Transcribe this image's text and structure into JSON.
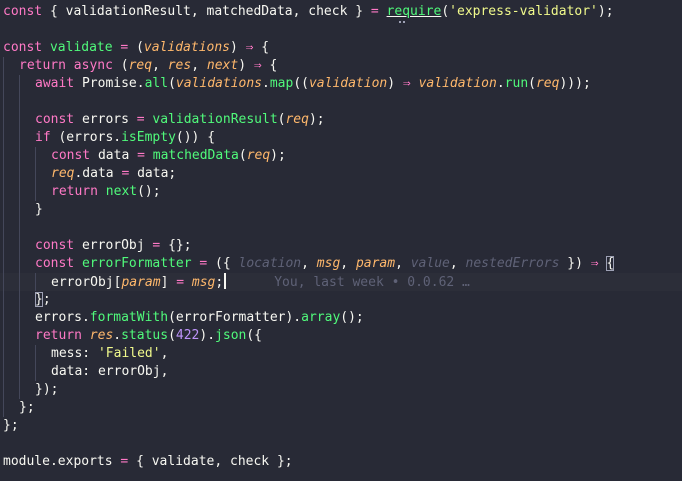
{
  "theme": {
    "background": "#282a36",
    "current_line": "#2c2e39",
    "plain": "#f8f8f2",
    "keyword": "#ff79c6",
    "function": "#50fa7b",
    "param": "#ffb86c",
    "string": "#f1fa8c",
    "number": "#bd93f9",
    "blame": "#5f6277",
    "guide": "#44475a"
  },
  "editor": {
    "current_line": 15,
    "git_blame": "You, last week • 0.0.62 …",
    "lines": [
      {
        "indent": 0,
        "tokens": [
          {
            "t": "const",
            "s": "kw"
          },
          {
            "t": " { ",
            "s": "pl"
          },
          {
            "t": "validationResult",
            "s": "pl"
          },
          {
            "t": ", ",
            "s": "pl"
          },
          {
            "t": "matchedData",
            "s": "pl"
          },
          {
            "t": ", ",
            "s": "pl"
          },
          {
            "t": "check",
            "s": "pl"
          },
          {
            "t": " } ",
            "s": "pl"
          },
          {
            "t": "=",
            "s": "kw"
          },
          {
            "t": " ",
            "s": "pl"
          },
          {
            "t": "require",
            "s": "fn",
            "deco": "ul"
          },
          {
            "t": "(",
            "s": "pl"
          },
          {
            "t": "'express-validator'",
            "s": "str"
          },
          {
            "t": ");",
            "s": "pl"
          }
        ]
      },
      {
        "indent": 0,
        "tokens": []
      },
      {
        "indent": 0,
        "tokens": [
          {
            "t": "const",
            "s": "kw"
          },
          {
            "t": " ",
            "s": "pl"
          },
          {
            "t": "validate",
            "s": "fn"
          },
          {
            "t": " ",
            "s": "pl"
          },
          {
            "t": "=",
            "s": "kw"
          },
          {
            "t": " (",
            "s": "pl"
          },
          {
            "t": "validations",
            "s": "par"
          },
          {
            "t": ") ",
            "s": "pl"
          },
          {
            "t": "⇒",
            "s": "kw"
          },
          {
            "t": " {",
            "s": "pl"
          }
        ]
      },
      {
        "indent": 1,
        "tokens": [
          {
            "t": "return",
            "s": "kw"
          },
          {
            "t": " ",
            "s": "pl"
          },
          {
            "t": "async",
            "s": "kw"
          },
          {
            "t": " (",
            "s": "pl"
          },
          {
            "t": "req",
            "s": "par"
          },
          {
            "t": ", ",
            "s": "pl"
          },
          {
            "t": "res",
            "s": "par"
          },
          {
            "t": ", ",
            "s": "pl"
          },
          {
            "t": "next",
            "s": "par"
          },
          {
            "t": ") ",
            "s": "pl"
          },
          {
            "t": "⇒",
            "s": "kw"
          },
          {
            "t": " {",
            "s": "pl"
          }
        ]
      },
      {
        "indent": 2,
        "tokens": [
          {
            "t": "await",
            "s": "kw"
          },
          {
            "t": " Promise.",
            "s": "pl"
          },
          {
            "t": "all",
            "s": "fn"
          },
          {
            "t": "(",
            "s": "pl"
          },
          {
            "t": "validations",
            "s": "par"
          },
          {
            "t": ".",
            "s": "pl"
          },
          {
            "t": "map",
            "s": "fn"
          },
          {
            "t": "((",
            "s": "pl"
          },
          {
            "t": "validation",
            "s": "par"
          },
          {
            "t": ") ",
            "s": "pl"
          },
          {
            "t": "⇒",
            "s": "kw"
          },
          {
            "t": " ",
            "s": "pl"
          },
          {
            "t": "validation",
            "s": "par"
          },
          {
            "t": ".",
            "s": "pl"
          },
          {
            "t": "run",
            "s": "fn"
          },
          {
            "t": "(",
            "s": "pl"
          },
          {
            "t": "req",
            "s": "par"
          },
          {
            "t": ")));",
            "s": "pl"
          }
        ]
      },
      {
        "indent": 2,
        "tokens": []
      },
      {
        "indent": 2,
        "tokens": [
          {
            "t": "const",
            "s": "kw"
          },
          {
            "t": " errors ",
            "s": "pl"
          },
          {
            "t": "=",
            "s": "kw"
          },
          {
            "t": " ",
            "s": "pl"
          },
          {
            "t": "validationResult",
            "s": "fn"
          },
          {
            "t": "(",
            "s": "pl"
          },
          {
            "t": "req",
            "s": "par"
          },
          {
            "t": ");",
            "s": "pl"
          }
        ]
      },
      {
        "indent": 2,
        "tokens": [
          {
            "t": "if",
            "s": "kw"
          },
          {
            "t": " (errors.",
            "s": "pl"
          },
          {
            "t": "isEmpty",
            "s": "fn"
          },
          {
            "t": "()) {",
            "s": "pl"
          }
        ]
      },
      {
        "indent": 3,
        "tokens": [
          {
            "t": "const",
            "s": "kw"
          },
          {
            "t": " data ",
            "s": "pl"
          },
          {
            "t": "=",
            "s": "kw"
          },
          {
            "t": " ",
            "s": "pl"
          },
          {
            "t": "matchedData",
            "s": "fn"
          },
          {
            "t": "(",
            "s": "pl"
          },
          {
            "t": "req",
            "s": "par"
          },
          {
            "t": ");",
            "s": "pl"
          }
        ]
      },
      {
        "indent": 3,
        "tokens": [
          {
            "t": "req",
            "s": "par"
          },
          {
            "t": ".data ",
            "s": "pl"
          },
          {
            "t": "=",
            "s": "kw"
          },
          {
            "t": " data;",
            "s": "pl"
          }
        ]
      },
      {
        "indent": 3,
        "tokens": [
          {
            "t": "return",
            "s": "kw"
          },
          {
            "t": " ",
            "s": "pl"
          },
          {
            "t": "next",
            "s": "fn"
          },
          {
            "t": "();",
            "s": "pl"
          }
        ]
      },
      {
        "indent": 2,
        "tokens": [
          {
            "t": "}",
            "s": "pl"
          }
        ]
      },
      {
        "indent": 2,
        "tokens": []
      },
      {
        "indent": 2,
        "tokens": [
          {
            "t": "const",
            "s": "kw"
          },
          {
            "t": " errorObj ",
            "s": "pl"
          },
          {
            "t": "=",
            "s": "kw"
          },
          {
            "t": " {};",
            "s": "pl"
          }
        ]
      },
      {
        "indent": 2,
        "tokens": [
          {
            "t": "const",
            "s": "kw"
          },
          {
            "t": " ",
            "s": "pl"
          },
          {
            "t": "errorFormatter",
            "s": "fn"
          },
          {
            "t": " ",
            "s": "pl"
          },
          {
            "t": "=",
            "s": "kw"
          },
          {
            "t": " ({ ",
            "s": "pl"
          },
          {
            "t": "location",
            "s": "cmt"
          },
          {
            "t": ", ",
            "s": "pl"
          },
          {
            "t": "msg",
            "s": "par"
          },
          {
            "t": ", ",
            "s": "pl"
          },
          {
            "t": "param",
            "s": "par"
          },
          {
            "t": ", ",
            "s": "pl"
          },
          {
            "t": "value",
            "s": "cmt"
          },
          {
            "t": ", ",
            "s": "pl"
          },
          {
            "t": "nestedErrors",
            "s": "cmt"
          },
          {
            "t": " }) ",
            "s": "pl"
          },
          {
            "t": "⇒",
            "s": "kw"
          },
          {
            "t": " ",
            "s": "pl"
          },
          {
            "t": "{",
            "s": "pl",
            "deco": "bm"
          }
        ]
      },
      {
        "indent": 3,
        "tokens": [
          {
            "t": "errorObj[",
            "s": "pl"
          },
          {
            "t": "param",
            "s": "par"
          },
          {
            "t": "] ",
            "s": "pl"
          },
          {
            "t": "=",
            "s": "kw"
          },
          {
            "t": " ",
            "s": "pl"
          },
          {
            "t": "msg",
            "s": "par"
          },
          {
            "t": ";",
            "s": "pl"
          }
        ]
      },
      {
        "indent": 2,
        "tokens": [
          {
            "t": "}",
            "s": "pl",
            "deco": "bm"
          },
          {
            "t": ";",
            "s": "pl"
          }
        ]
      },
      {
        "indent": 2,
        "tokens": [
          {
            "t": "errors.",
            "s": "pl"
          },
          {
            "t": "formatWith",
            "s": "fn"
          },
          {
            "t": "(errorFormatter).",
            "s": "pl"
          },
          {
            "t": "array",
            "s": "fn"
          },
          {
            "t": "();",
            "s": "pl"
          }
        ]
      },
      {
        "indent": 2,
        "tokens": [
          {
            "t": "return",
            "s": "kw"
          },
          {
            "t": " ",
            "s": "pl"
          },
          {
            "t": "res",
            "s": "par"
          },
          {
            "t": ".",
            "s": "pl"
          },
          {
            "t": "status",
            "s": "fn"
          },
          {
            "t": "(",
            "s": "pl"
          },
          {
            "t": "422",
            "s": "num"
          },
          {
            "t": ").",
            "s": "pl"
          },
          {
            "t": "json",
            "s": "fn"
          },
          {
            "t": "({",
            "s": "pl"
          }
        ]
      },
      {
        "indent": 3,
        "tokens": [
          {
            "t": "mess:",
            "s": "pl"
          },
          {
            "t": " ",
            "s": "pl"
          },
          {
            "t": "'Failed'",
            "s": "str"
          },
          {
            "t": ",",
            "s": "pl"
          }
        ]
      },
      {
        "indent": 3,
        "tokens": [
          {
            "t": "data: errorObj,",
            "s": "pl"
          }
        ]
      },
      {
        "indent": 2,
        "tokens": [
          {
            "t": "});",
            "s": "pl"
          }
        ]
      },
      {
        "indent": 1,
        "tokens": [
          {
            "t": "};",
            "s": "pl"
          }
        ]
      },
      {
        "indent": 0,
        "tokens": [
          {
            "t": "};",
            "s": "pl"
          }
        ]
      },
      {
        "indent": 0,
        "tokens": []
      },
      {
        "indent": 0,
        "tokens": [
          {
            "t": "module",
            "s": "pl"
          },
          {
            "t": ".",
            "s": "pl"
          },
          {
            "t": "exports",
            "s": "pl"
          },
          {
            "t": " ",
            "s": "pl"
          },
          {
            "t": "=",
            "s": "kw"
          },
          {
            "t": " { validate, check };",
            "s": "pl"
          }
        ]
      }
    ]
  }
}
